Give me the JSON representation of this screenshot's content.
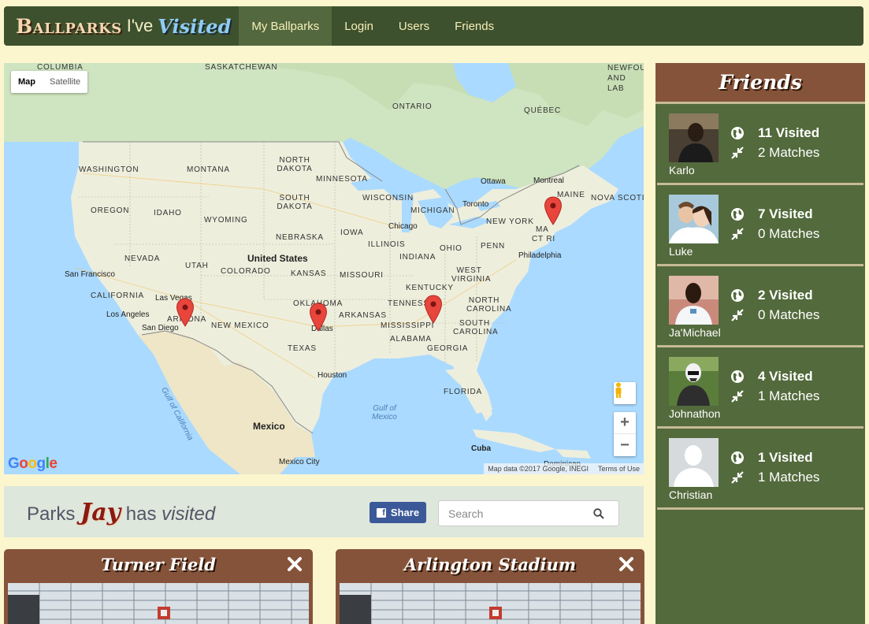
{
  "brand": {
    "part1": "Ballparks",
    "part2": "I've",
    "part3": "Visited"
  },
  "nav": [
    {
      "label": "My Ballparks",
      "active": true
    },
    {
      "label": "Login",
      "active": false
    },
    {
      "label": "Users",
      "active": false
    },
    {
      "label": "Friends",
      "active": false
    }
  ],
  "map": {
    "type_map": "Map",
    "type_satellite": "Satellite",
    "zoom_in": "+",
    "zoom_out": "−",
    "attribution": "Map data ©2017 Google, INEGI",
    "terms": "Terms of Use",
    "google_logo": "Google",
    "labels": {
      "columbia": "COLUMBIA",
      "saskatchewan": "SASKATCHEWAN",
      "ontario": "ONTARIO",
      "quebec": "QUÉBEC",
      "newfoundland": "NEWFOU AND LAB",
      "washington": "WASHINGTON",
      "montana": "MONTANA",
      "north_dakota": "NORTH DAKOTA",
      "minnesota": "MINNESOTA",
      "ottawa": "Ottawa",
      "montreal": "Montreal",
      "maine": "MAINE",
      "nova_scotia": "NOVA SCOTI",
      "oregon": "OREGON",
      "idaho": "IDAHO",
      "south_dakota": "SOUTH DAKOTA",
      "wisconsin": "WISCONSIN",
      "michigan": "MICHIGAN",
      "toronto": "Toronto",
      "new_york": "NEW YORK",
      "wyoming": "WYOMING",
      "chicago": "Chicago",
      "nebraska": "NEBRASKA",
      "iowa": "IOWA",
      "ma": "MA",
      "ctri": "CT RI",
      "penn": "PENN",
      "nevada": "NEVADA",
      "united_states": "United States",
      "illinois": "ILLINOIS",
      "ohio": "OHIO",
      "philadelphia": "Philadelphia",
      "indiana": "INDIANA",
      "utah": "UTAH",
      "colorado": "COLORADO",
      "kansas": "KANSAS",
      "missouri": "MISSOURI",
      "west_virginia": "WEST VIRGINIA",
      "san_francisco": "San Francisco",
      "kentucky": "KENTUCKY",
      "california": "CALIFORNIA",
      "las_vegas": "Las Vegas",
      "oklahoma": "OKLAHOMA",
      "tennessee": "TENNESSEE",
      "north_carolina": "NORTH CAROLINA",
      "los_angeles": "Los Angeles",
      "arizona": "ARIZONA",
      "arkansas": "ARKANSAS",
      "san_diego": "San Diego",
      "new_mexico": "NEW MEXICO",
      "dallas": "Dallas",
      "mississippi": "MISSISSIPPI",
      "south_carolina": "SOUTH CAROLINA",
      "texas": "TEXAS",
      "alabama": "ALABAMA",
      "georgia": "GEORGIA",
      "houston": "Houston",
      "gulf_california": "Gulf of California",
      "florida": "FLORIDA",
      "gulf_mexico": "Gulf of Mexico",
      "mexico": "Mexico",
      "cuba": "Cuba",
      "mexico_city": "Mexico City",
      "dominican": "Dominican"
    }
  },
  "parks_header": {
    "prefix": "Parks",
    "user": "Jay",
    "has": "has",
    "visited": "visited",
    "share_label": "Share",
    "search_placeholder": "Search"
  },
  "parks": [
    {
      "name": "Turner Field"
    },
    {
      "name": "Arlington Stadium"
    }
  ],
  "friends": {
    "title": "Friends",
    "list": [
      {
        "name": "Karlo",
        "visited": "11 Visited",
        "matches": "2 Matches"
      },
      {
        "name": "Luke",
        "visited": "7 Visited",
        "matches": "0 Matches"
      },
      {
        "name": "Ja'Michael",
        "visited": "2 Visited",
        "matches": "0 Matches"
      },
      {
        "name": "Johnathon",
        "visited": "4 Visited",
        "matches": "1 Matches"
      },
      {
        "name": "Christian",
        "visited": "1 Visited",
        "matches": "1 Matches"
      }
    ]
  },
  "colors": {
    "navbar": "#3e512e",
    "friends_panel": "#536a3c",
    "card_header": "#85533a",
    "page_bg": "#fcf6cf",
    "facebook": "#3b5998",
    "marker": "#e8453c"
  }
}
